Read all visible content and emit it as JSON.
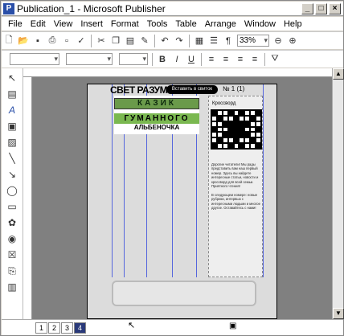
{
  "window": {
    "title": "Publication_1 - Microsoft Publisher",
    "app_icon": "P"
  },
  "menu": [
    "File",
    "Edit",
    "View",
    "Insert",
    "Format",
    "Tools",
    "Table",
    "Arrange",
    "Window",
    "Help"
  ],
  "toolbar": {
    "zoom": "33%"
  },
  "page": {
    "masthead": "СВЕТ РАЗУМА",
    "tooltip": "Вставить в свиток",
    "issue": "№ 1 (1)",
    "green_line1": "КАЗИК",
    "green_line2": "ГУМАННОГО",
    "green_line3": "АЛЬБЕНОЧКА",
    "crossword_title": "Кроссворд",
    "text1": "Дорогие читатели! Мы рады представить вам наш первый номер. Здесь вы найдете интересные статьи, новости и кроссворд для всей семьи. Приятного чтения!",
    "text2": "В следующем номере: новые рубрики, интервью с интересными людьми и многое другое. Оставайтесь с нами!"
  },
  "pages": [
    "1",
    "2",
    "3",
    "4"
  ],
  "active_page": "4"
}
